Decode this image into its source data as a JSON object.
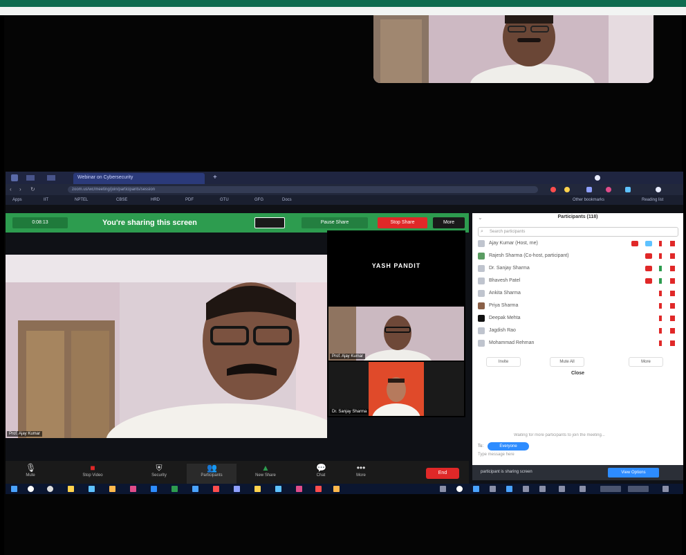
{
  "share_bar": {
    "timer": "0:08:13",
    "message": "You're sharing this screen",
    "pause_label": "Pause Share",
    "stop_label": "Stop Share",
    "more_label": "More"
  },
  "browser": {
    "tab_title": "Webinar on Cybersecurity",
    "url": "zoom.us/wc/meeting/join/participants/session",
    "bookmarks": [
      "Apps",
      "IIT",
      "NPTEL",
      "CBSE",
      "HRD",
      "PDF",
      "GTU",
      "GFG",
      "Docs",
      "Other bookmarks",
      "Reading list"
    ]
  },
  "gallery": {
    "speaker_name": "YASH PANDIT",
    "tile1_label": "Prof. Ajay Kumar",
    "tile2_label": "Dr. Sanjay Sharma"
  },
  "main_video": {
    "name_label": "Prof. Ajay Kumar"
  },
  "participants": {
    "header": "Participants (118)",
    "search_placeholder": "Search participants",
    "rows": [
      {
        "name": "Ajay Kumar (Host, me)"
      },
      {
        "name": "Rajesh Sharma (Co-host, participant)"
      },
      {
        "name": "Dr. Sanjay Sharma"
      },
      {
        "name": "Bhavesh Patel"
      },
      {
        "name": "Ankita Sharma"
      },
      {
        "name": "Priya Sharma"
      },
      {
        "name": "Deepak Mehta"
      },
      {
        "name": "Jagdish Rao"
      },
      {
        "name": "Mohammad Rehman"
      }
    ],
    "invite_label": "Invite",
    "mute_all_label": "Mute All",
    "more_label": "More",
    "close_label": "Close"
  },
  "chat": {
    "message": "Waiting for more participants to join the meeting...",
    "to_label": "To:",
    "recipient": "Everyone",
    "input_placeholder": "Type message here",
    "bar_text": "participant is sharing screen",
    "view_button": "View Options"
  },
  "controls": [
    {
      "label": "Mute",
      "icon": "mic-icon"
    },
    {
      "label": "Stop Video",
      "icon": "video-icon"
    },
    {
      "label": "Security",
      "icon": "shield-icon"
    },
    {
      "label": "Participants",
      "icon": "users-icon"
    },
    {
      "label": "New Share",
      "icon": "share-icon"
    },
    {
      "label": "Chat",
      "icon": "chat-icon"
    },
    {
      "label": "More",
      "icon": "more-icon"
    }
  ],
  "end_label": "End",
  "colors": {
    "zoom_green": "#2d9c4f",
    "end_red": "#e02828",
    "zoom_blue": "#2d8cff"
  }
}
